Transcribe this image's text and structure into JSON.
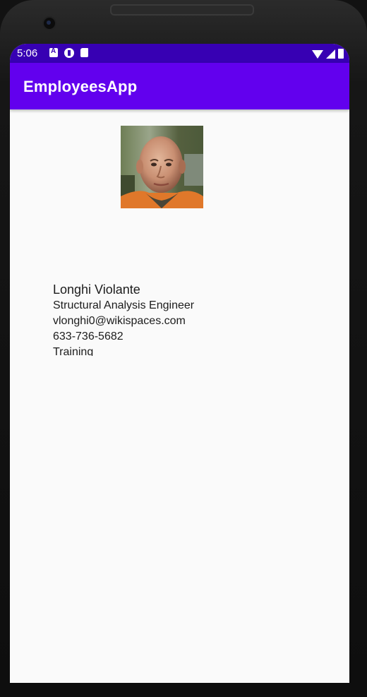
{
  "status_bar": {
    "time": "5:06",
    "icons": [
      "text-a-icon",
      "p-app-icon",
      "sd-card-icon",
      "wifi-icon",
      "signal-icon",
      "battery-icon"
    ],
    "background": "#3700b3"
  },
  "app_bar": {
    "title": "EmployeesApp",
    "background": "#6200ee"
  },
  "employee": {
    "photo_icon": "employee-photo",
    "name": "Longhi Violante",
    "title": "Structural Analysis Engineer",
    "email": "vlonghi0@wikispaces.com",
    "phone": "633-736-5682",
    "department": "Training"
  }
}
